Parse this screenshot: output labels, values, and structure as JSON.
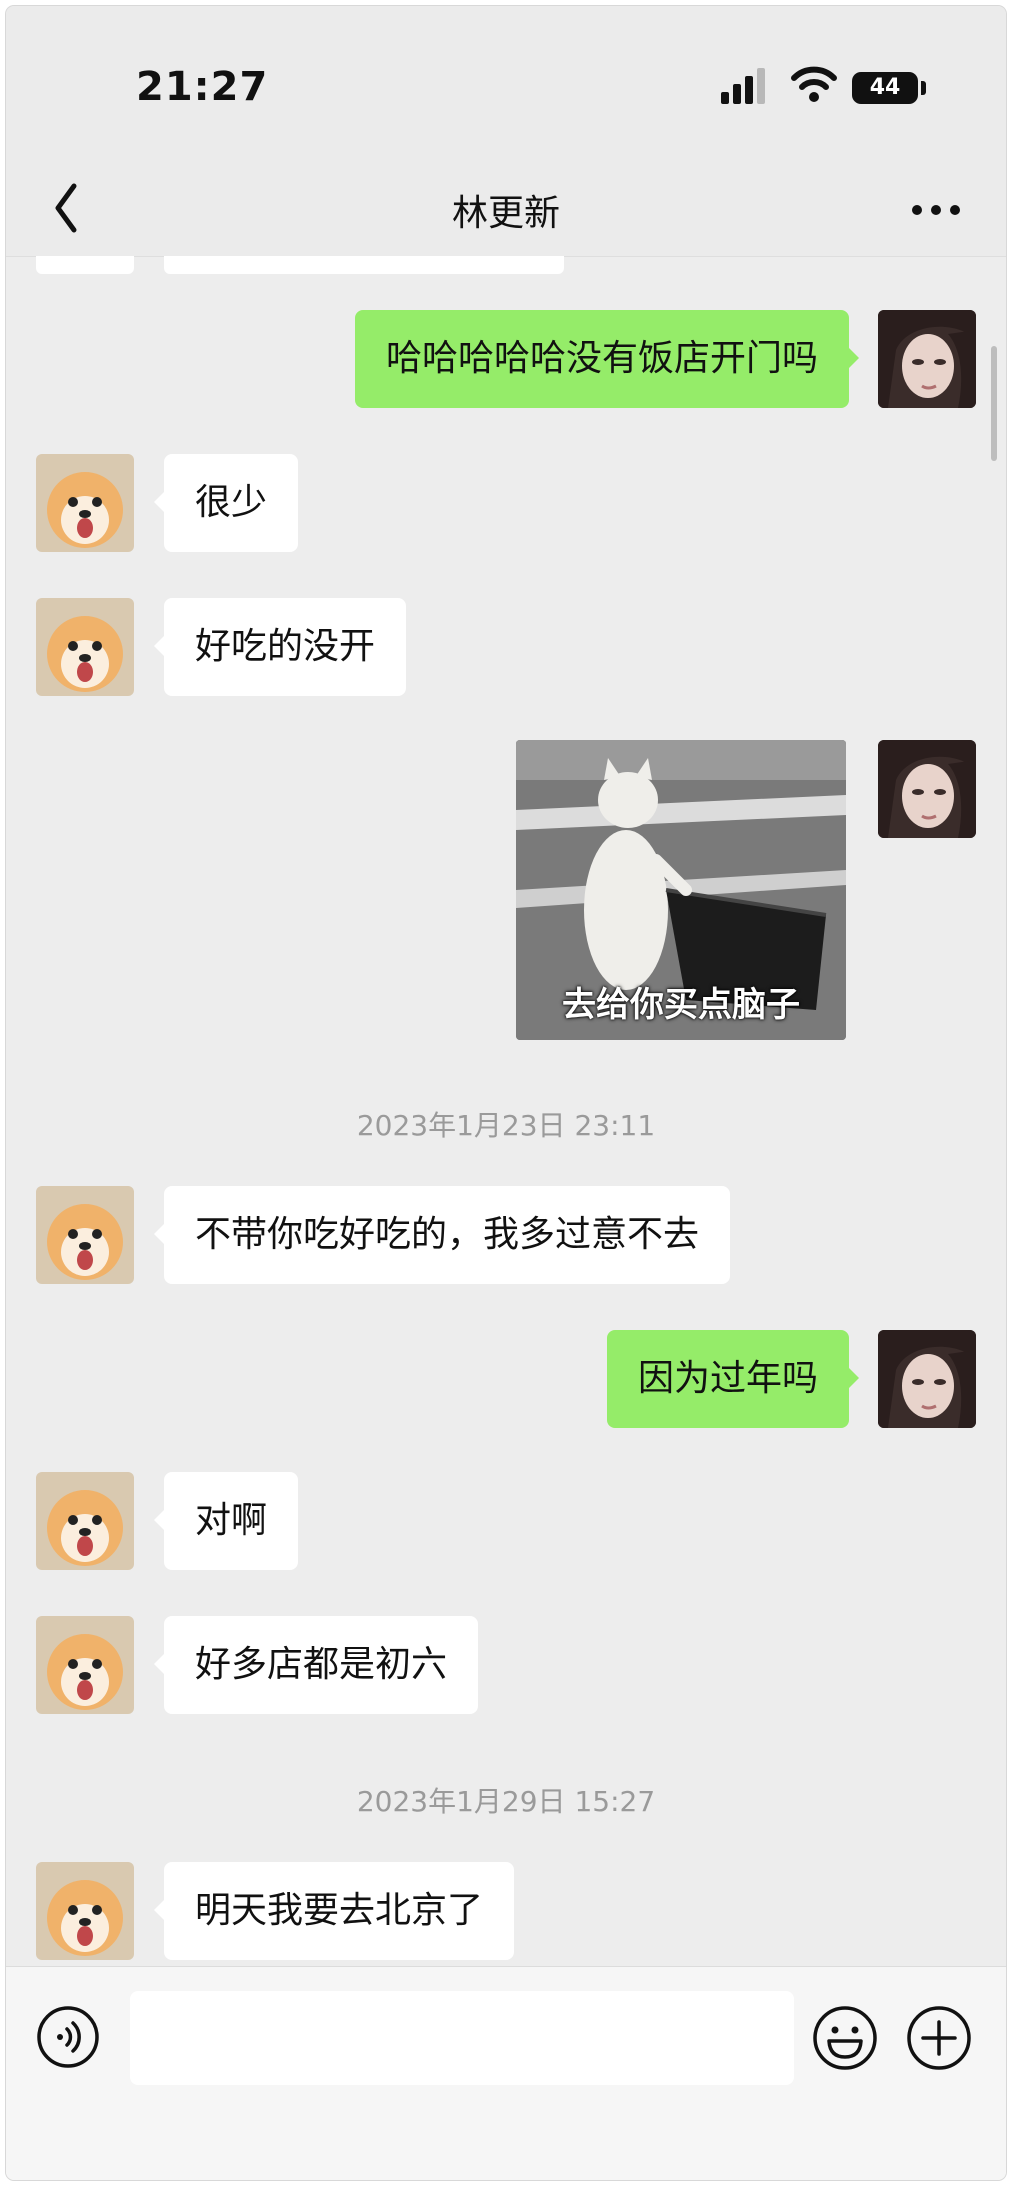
{
  "status_bar": {
    "time": "21:27",
    "battery": "44"
  },
  "nav": {
    "title": "林更新",
    "back_icon": "chevron-left-icon",
    "more_icon": "more-dots-icon"
  },
  "messages": [
    {
      "side": "right",
      "text": "哈哈哈哈哈没有饭店开门吗"
    },
    {
      "side": "left",
      "text": "很少"
    },
    {
      "side": "left",
      "text": "好吃的没开"
    },
    {
      "side": "right",
      "type": "sticker",
      "caption": "去给你买点脑子"
    },
    {
      "type": "timestamp",
      "text": "2023年1月23日 23:11"
    },
    {
      "side": "left",
      "text": "不带你吃好吃的，我多过意不去"
    },
    {
      "side": "right",
      "text": "因为过年吗"
    },
    {
      "side": "left",
      "text": "对啊"
    },
    {
      "side": "left",
      "text": "好多店都是初六"
    },
    {
      "type": "timestamp",
      "text": "2023年1月29日 15:27"
    },
    {
      "side": "left",
      "text": "明天我要去北京了"
    }
  ],
  "input_bar": {
    "voice_icon": "voice-icon",
    "emoji_icon": "emoji-icon",
    "plus_icon": "plus-icon"
  },
  "colors": {
    "self_bubble": "#95ec69",
    "other_bubble": "#ffffff",
    "chat_bg": "#ededed"
  }
}
